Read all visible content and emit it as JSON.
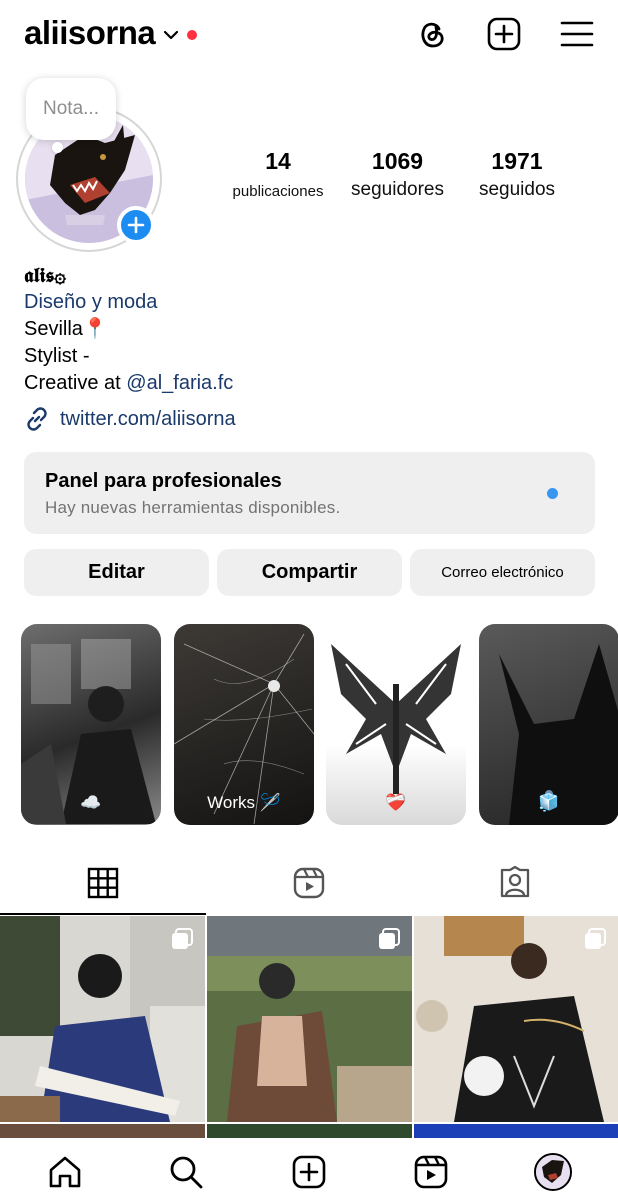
{
  "header": {
    "username": "aliisorna",
    "icons": [
      "chevron-down-icon",
      "threads-icon",
      "new-post-icon",
      "menu-icon"
    ],
    "notification_color": "#ff3040"
  },
  "note": {
    "placeholder": "Nota..."
  },
  "stats": [
    {
      "value": "14",
      "label": "publicaciones"
    },
    {
      "value": "1069",
      "label": "seguidores"
    },
    {
      "value": "1971",
      "label": "seguidos"
    }
  ],
  "bio": {
    "name": "𝖆𝖑𝖎𝖘۞",
    "category": "Diseño y moda",
    "line1": "Sevilla📍",
    "line2": "Stylist -",
    "line3_prefix": "Creative at ",
    "line3_mention": "@al_faria.fc",
    "link": "twitter.com/aliisorna"
  },
  "panel": {
    "title": "Panel para profesionales",
    "subtitle": "Hay nuevas herramientas disponibles.",
    "dot_color": "#3897f0"
  },
  "buttons": {
    "edit": "Editar",
    "share": "Compartir",
    "email": "Correo electrónico"
  },
  "highlights": [
    {
      "label": "☁️"
    },
    {
      "label": "Works 🪡"
    },
    {
      "label": "❤️‍🩹"
    },
    {
      "label": "🧊"
    }
  ],
  "tabs": [
    "grid-icon",
    "reels-icon",
    "tagged-icon"
  ],
  "nav": [
    "home-icon",
    "search-icon",
    "create-icon",
    "reels-icon",
    "profile-avatar"
  ],
  "colors": {
    "link": "#1a3a6b",
    "accent": "#1d8cf0",
    "surface": "#efefef"
  }
}
